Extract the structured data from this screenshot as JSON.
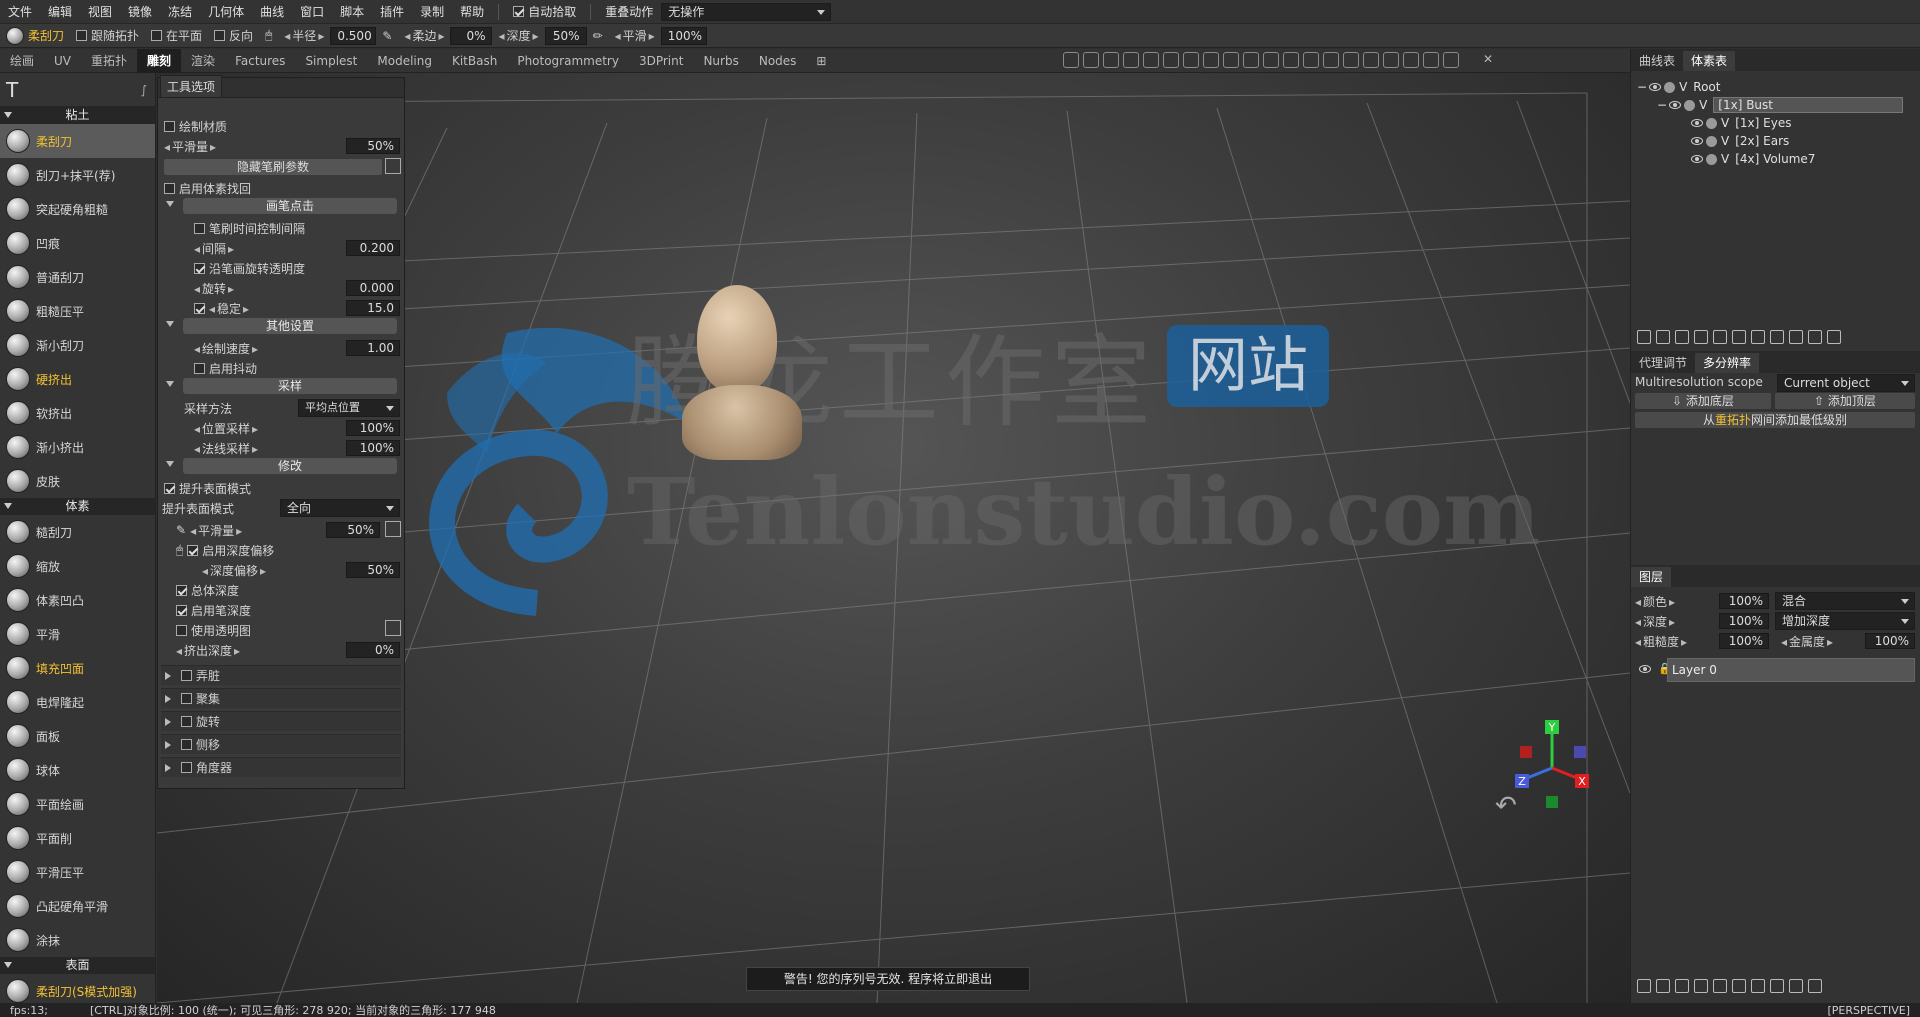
{
  "menu": {
    "items": [
      "文件",
      "编辑",
      "视图",
      "镜像",
      "冻结",
      "几何体",
      "曲线",
      "窗口",
      "脚本",
      "插件",
      "录制",
      "帮助"
    ],
    "auto_pick": "自动拾取",
    "overlay_label": "重叠动作",
    "overlay_value": "无操作"
  },
  "toolbar": {
    "tool_name": "柔刮刀",
    "follow_topo": "跟随拓扑",
    "on_plane": "在平面",
    "reverse": "反向",
    "radius_label": "半径",
    "radius_value": "0.500",
    "soft_label": "柔边",
    "soft_value": "0%",
    "depth_label": "深度",
    "depth_value": "50%",
    "smooth_label": "平滑",
    "smooth_value": "100%"
  },
  "tabs": [
    "绘画",
    "UV",
    "重拓扑",
    "雕刻",
    "渲染",
    "Factures",
    "Simplest",
    "Modeling",
    "KitBash",
    "Photogrammetry",
    "3DPrint",
    "Nurbs",
    "Nodes"
  ],
  "tools": {
    "clay_head": "粘土",
    "clay": [
      "柔刮刀",
      "刮刀+抹平(荐)",
      "突起硬角粗糙",
      "凹痕",
      "普通刮刀",
      "粗糙压平",
      "渐小刮刀",
      "硬挤出",
      "软挤出",
      "渐小挤出",
      "皮肤"
    ],
    "voxel_head": "体素",
    "voxel": [
      "糙刮刀",
      "缩放",
      "体素凹凸",
      "平滑",
      "填充凹面",
      "电焊隆起",
      "面板",
      "球体",
      "平面绘画",
      "平面削",
      "平滑压平",
      "凸起硬角平滑",
      "涂抹"
    ],
    "surface_head": "表面",
    "surface": [
      "柔刮刀(S模式加强)"
    ]
  },
  "options": {
    "tab": "工具选项",
    "paint_material": "绘制材质",
    "smooth_label": "平滑量",
    "smooth_value": "50%",
    "hide_brush": "隐藏笔刷参数",
    "enable_voxel_fallback": "启用体素找回",
    "stroke_head": "画笔点击",
    "stroke_time": "笔刷时间控制间隔",
    "spacing_label": "间隔",
    "spacing_value": "0.200",
    "rotate_opacity": "沿笔画旋转透明度",
    "rotation_label": "旋转",
    "rotation_value": "0.000",
    "stable_label": "稳定",
    "stable_value": "15.0",
    "other_head": "其他设置",
    "draw_speed_label": "绘制速度",
    "draw_speed_value": "1.00",
    "jitter": "启用抖动",
    "sampling_head": "采样",
    "sample_method_label": "采样方法",
    "sample_method_value": "平均点位置",
    "pos_sample_label": "位置采样",
    "pos_sample_value": "100%",
    "normal_sample_label": "法线采样",
    "normal_sample_value": "100%",
    "modify_head": "修改",
    "lift_mode_check": "提升表面模式",
    "lift_mode_label": "提升表面模式",
    "lift_mode_value": "全向",
    "smooth2_label": "平滑量",
    "smooth2_value": "50%",
    "depth_offset": "启用深度偏移",
    "depth_offset_label": "深度偏移",
    "depth_offset_value": "50%",
    "total_depth": "总体深度",
    "pen_depth": "启用笔深度",
    "use_transparency": "使用透明图",
    "extrude_label": "挤出深度",
    "extrude_value": "0%",
    "collapsed": [
      "弄脏",
      "聚集",
      "旋转",
      "侧移",
      "角度器"
    ]
  },
  "watermark": {
    "cn": "腾龙工作室",
    "site": "网站",
    "en": "Tenlonstudio.com"
  },
  "warning": "警告! 您的序列号无效. 程序将立即退出",
  "right": {
    "tabs_top": [
      "曲线表",
      "体素表"
    ],
    "tree": [
      {
        "label": "Root"
      },
      {
        "label": "[1x] Bust"
      },
      {
        "label": "[1x] Eyes"
      },
      {
        "label": "[2x] Ears"
      },
      {
        "label": "[4x] Volume7"
      }
    ],
    "tabs_mid": [
      "代理调节",
      "多分辨率"
    ],
    "multires_label": "Multiresolution scope",
    "multires_value": "Current object",
    "add_lower": "添加底层",
    "add_upper": "添加顶层",
    "retopo_note_pre": "从",
    "retopo_note_hl": "重拓扑",
    "retopo_note_post": "网间添加最低级别",
    "layers_tab": "图层",
    "color_label": "颜色",
    "color_value": "100%",
    "blend": "混合",
    "depth_label": "深度",
    "depth_value": "100%",
    "depth_mode": "增加深度",
    "rough_label": "粗糙度",
    "rough_value": "100%",
    "metal_label": "金属度",
    "metal_value": "100%",
    "layer_name": "Layer 0"
  },
  "status": {
    "fps": "fps:13;",
    "info": "[CTRL]对象比例: 100 (统一); 可见三角形: 278 920; 当前对象的三角形: 177 948",
    "view": "[PERSPECTIVE]"
  },
  "gizmo": {
    "x": "X",
    "y": "Y",
    "z": "Z"
  }
}
